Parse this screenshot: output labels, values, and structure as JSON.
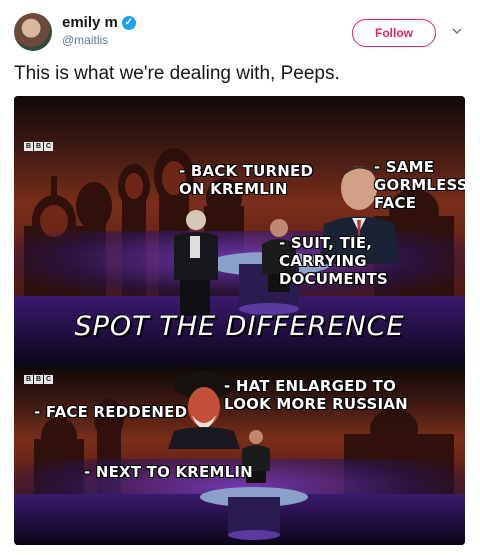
{
  "user": {
    "name": "emily m",
    "handle": "@maitlis",
    "follow_label": "Follow",
    "verified": true
  },
  "tweet": {
    "text": "This is what we're dealing with, Peeps."
  },
  "media": {
    "top_panel": {
      "logo": [
        "B",
        "B",
        "C"
      ],
      "captions": {
        "back_turned": "- BACK TURNED\nON KREMLIN",
        "same_face": "- SAME\nGORMLESS\nFACE",
        "suit": "- SUIT, TIE,\nCARRYING\nDOCUMENTS"
      },
      "headline": "SPOT THE DIFFERENCE"
    },
    "bottom_panel": {
      "logo": [
        "B",
        "B",
        "C"
      ],
      "captions": {
        "hat": "- HAT ENLARGED TO\nLOOK MORE RUSSIAN",
        "face": "- FACE REDDENED",
        "kremlin": "- NEXT TO KREMLIN"
      }
    }
  },
  "colors": {
    "accent": "#e0245e",
    "verified": "#1da1f2",
    "secondary_text": "#657786"
  }
}
